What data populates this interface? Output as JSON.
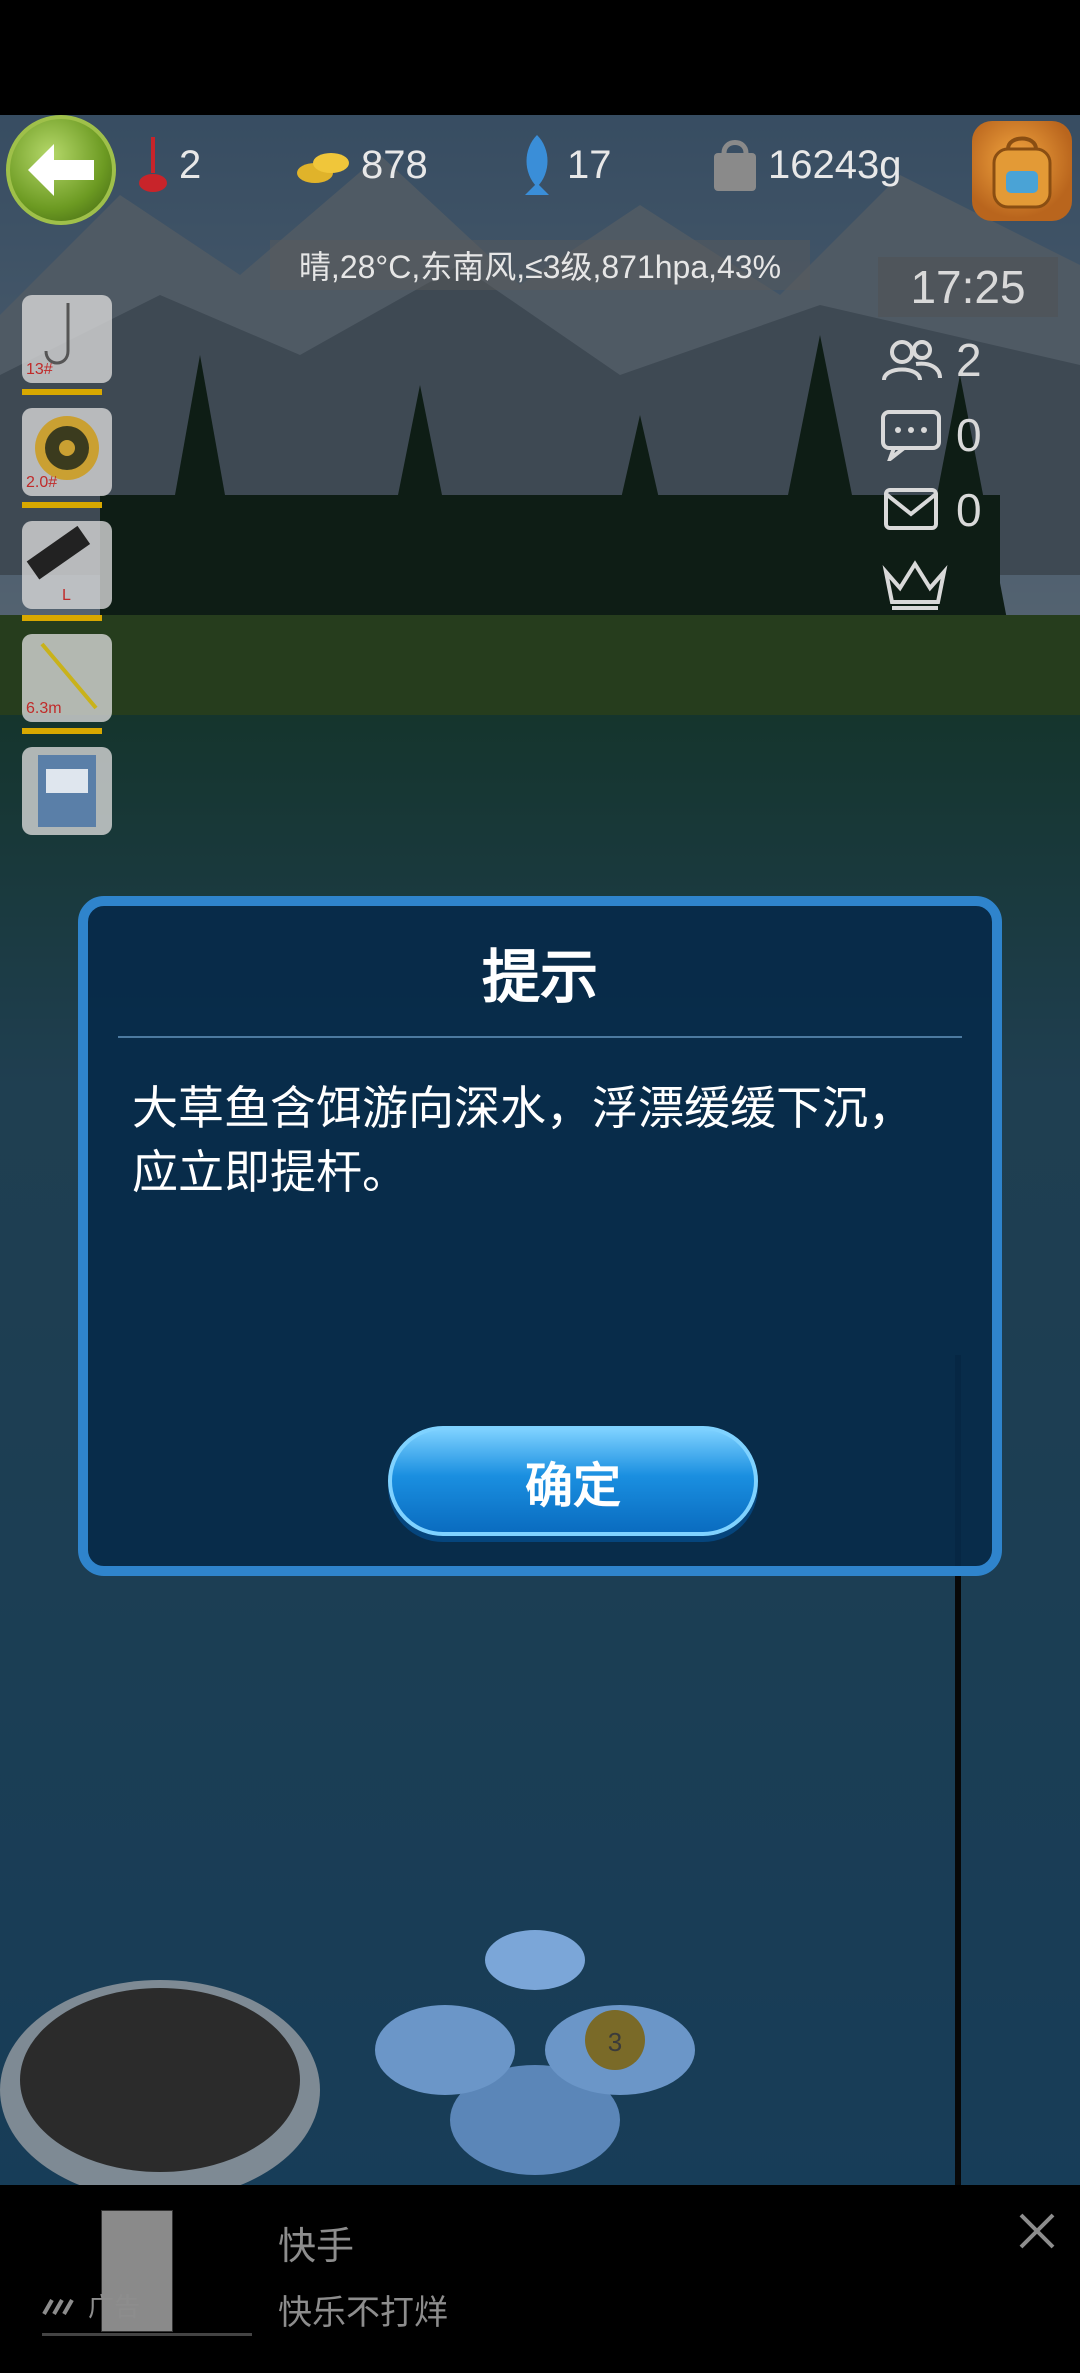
{
  "hud": {
    "floats": "2",
    "coins": "878",
    "fish": "17",
    "weight": "16243g"
  },
  "weather": "晴,28°C,东南风,≤3级,871hpa,43%",
  "clock": "17:25",
  "side": {
    "players": "2",
    "messages": "0",
    "mail": "0"
  },
  "tackle": [
    {
      "label": "13#"
    },
    {
      "label": "2.0#"
    },
    {
      "label": "L"
    },
    {
      "label": "6.3m"
    }
  ],
  "dialog": {
    "title": "提示",
    "message": "大草鱼含饵游向深水，浮漂缓缓下沉，应立即提杆。",
    "ok_label": "确定"
  },
  "bait_count": "3",
  "ad": {
    "title": "快手",
    "subtitle": "快乐不打烊",
    "tag": "广告"
  },
  "colors": {
    "dialog_border": "#2f84cc",
    "dialog_bg": "#072a4a",
    "ok_button": "#1a8fe0"
  }
}
